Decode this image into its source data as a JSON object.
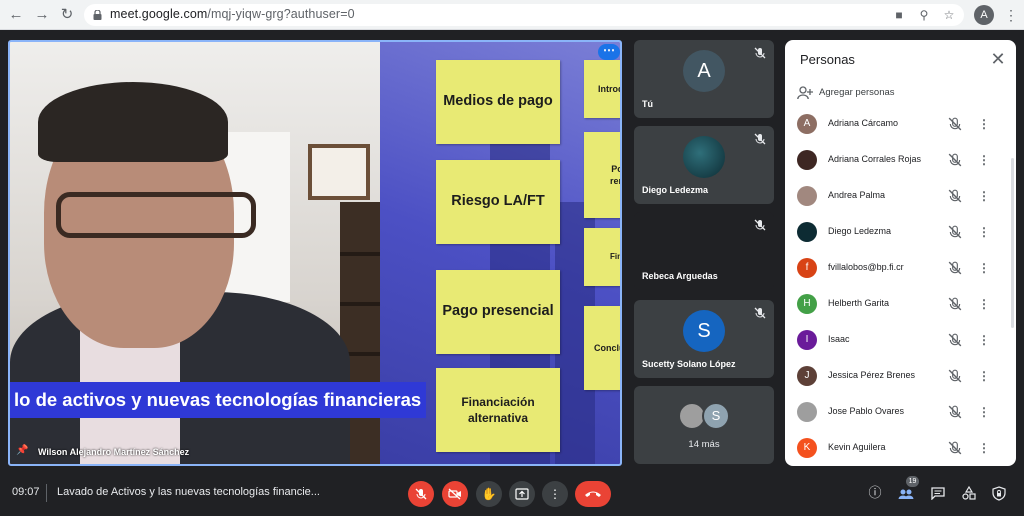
{
  "browser": {
    "url_host": "meet.google.com",
    "url_path": "/mqj-yiqw-grg?authuser=0",
    "profile_initial": "A",
    "icons": [
      "back-icon",
      "forward-icon",
      "reload-icon",
      "lock-icon",
      "camera-icon",
      "zoom-icon",
      "star-icon",
      "menu-icon"
    ]
  },
  "main_tile": {
    "banner_text": "lo de activos y nuevas tecnologías financieras",
    "speaker_name": "Wilson Alejandro Martínez Sánchez",
    "sticky_notes": [
      "Medios de pago",
      "Riesgo LA/FT",
      "Pago presencial",
      "Financiación alternativa"
    ],
    "partial_notes": [
      "Introd",
      "Po ren",
      "Fin",
      "Conclu"
    ]
  },
  "side_tiles": [
    {
      "name": "Tú",
      "initial": "A",
      "color": "#425662"
    },
    {
      "name": "Diego Ledezma",
      "initial": "",
      "color": "#0d2b33"
    },
    {
      "name": "Rebeca Arguedas",
      "initial": "",
      "color": "#202124"
    },
    {
      "name": "Sucetty Solano López",
      "initial": "S",
      "color": "#1565c0"
    }
  ],
  "more_tile": {
    "label": "14 más",
    "mini_initial": "S"
  },
  "people_panel": {
    "title": "Personas",
    "add_label": "Agregar personas",
    "people": [
      {
        "name": "Adriana Cárcamo",
        "initial": "A",
        "color": "#8d6e63"
      },
      {
        "name": "Adriana Corrales Rojas",
        "initial": "",
        "color": "#3e2723"
      },
      {
        "name": "Andrea Palma",
        "initial": "",
        "color": "#a1887f"
      },
      {
        "name": "Diego Ledezma",
        "initial": "",
        "color": "#0d2b33"
      },
      {
        "name": "fvillalobos@bp.fi.cr",
        "initial": "f",
        "color": "#d84315"
      },
      {
        "name": "Helberth Garita",
        "initial": "H",
        "color": "#43a047"
      },
      {
        "name": "Isaac",
        "initial": "I",
        "color": "#6a1b9a"
      },
      {
        "name": "Jessica Pérez Brenes",
        "initial": "J",
        "color": "#5d4037"
      },
      {
        "name": "Jose Pablo Ovares",
        "initial": "",
        "color": "#9e9e9e"
      },
      {
        "name": "Kevin Aguilera",
        "initial": "K",
        "color": "#f4511e"
      }
    ]
  },
  "bottom_bar": {
    "time": "09:07",
    "meeting_title": "Lavado de Activos y las nuevas tecnologías financie...",
    "participant_count": "19"
  }
}
